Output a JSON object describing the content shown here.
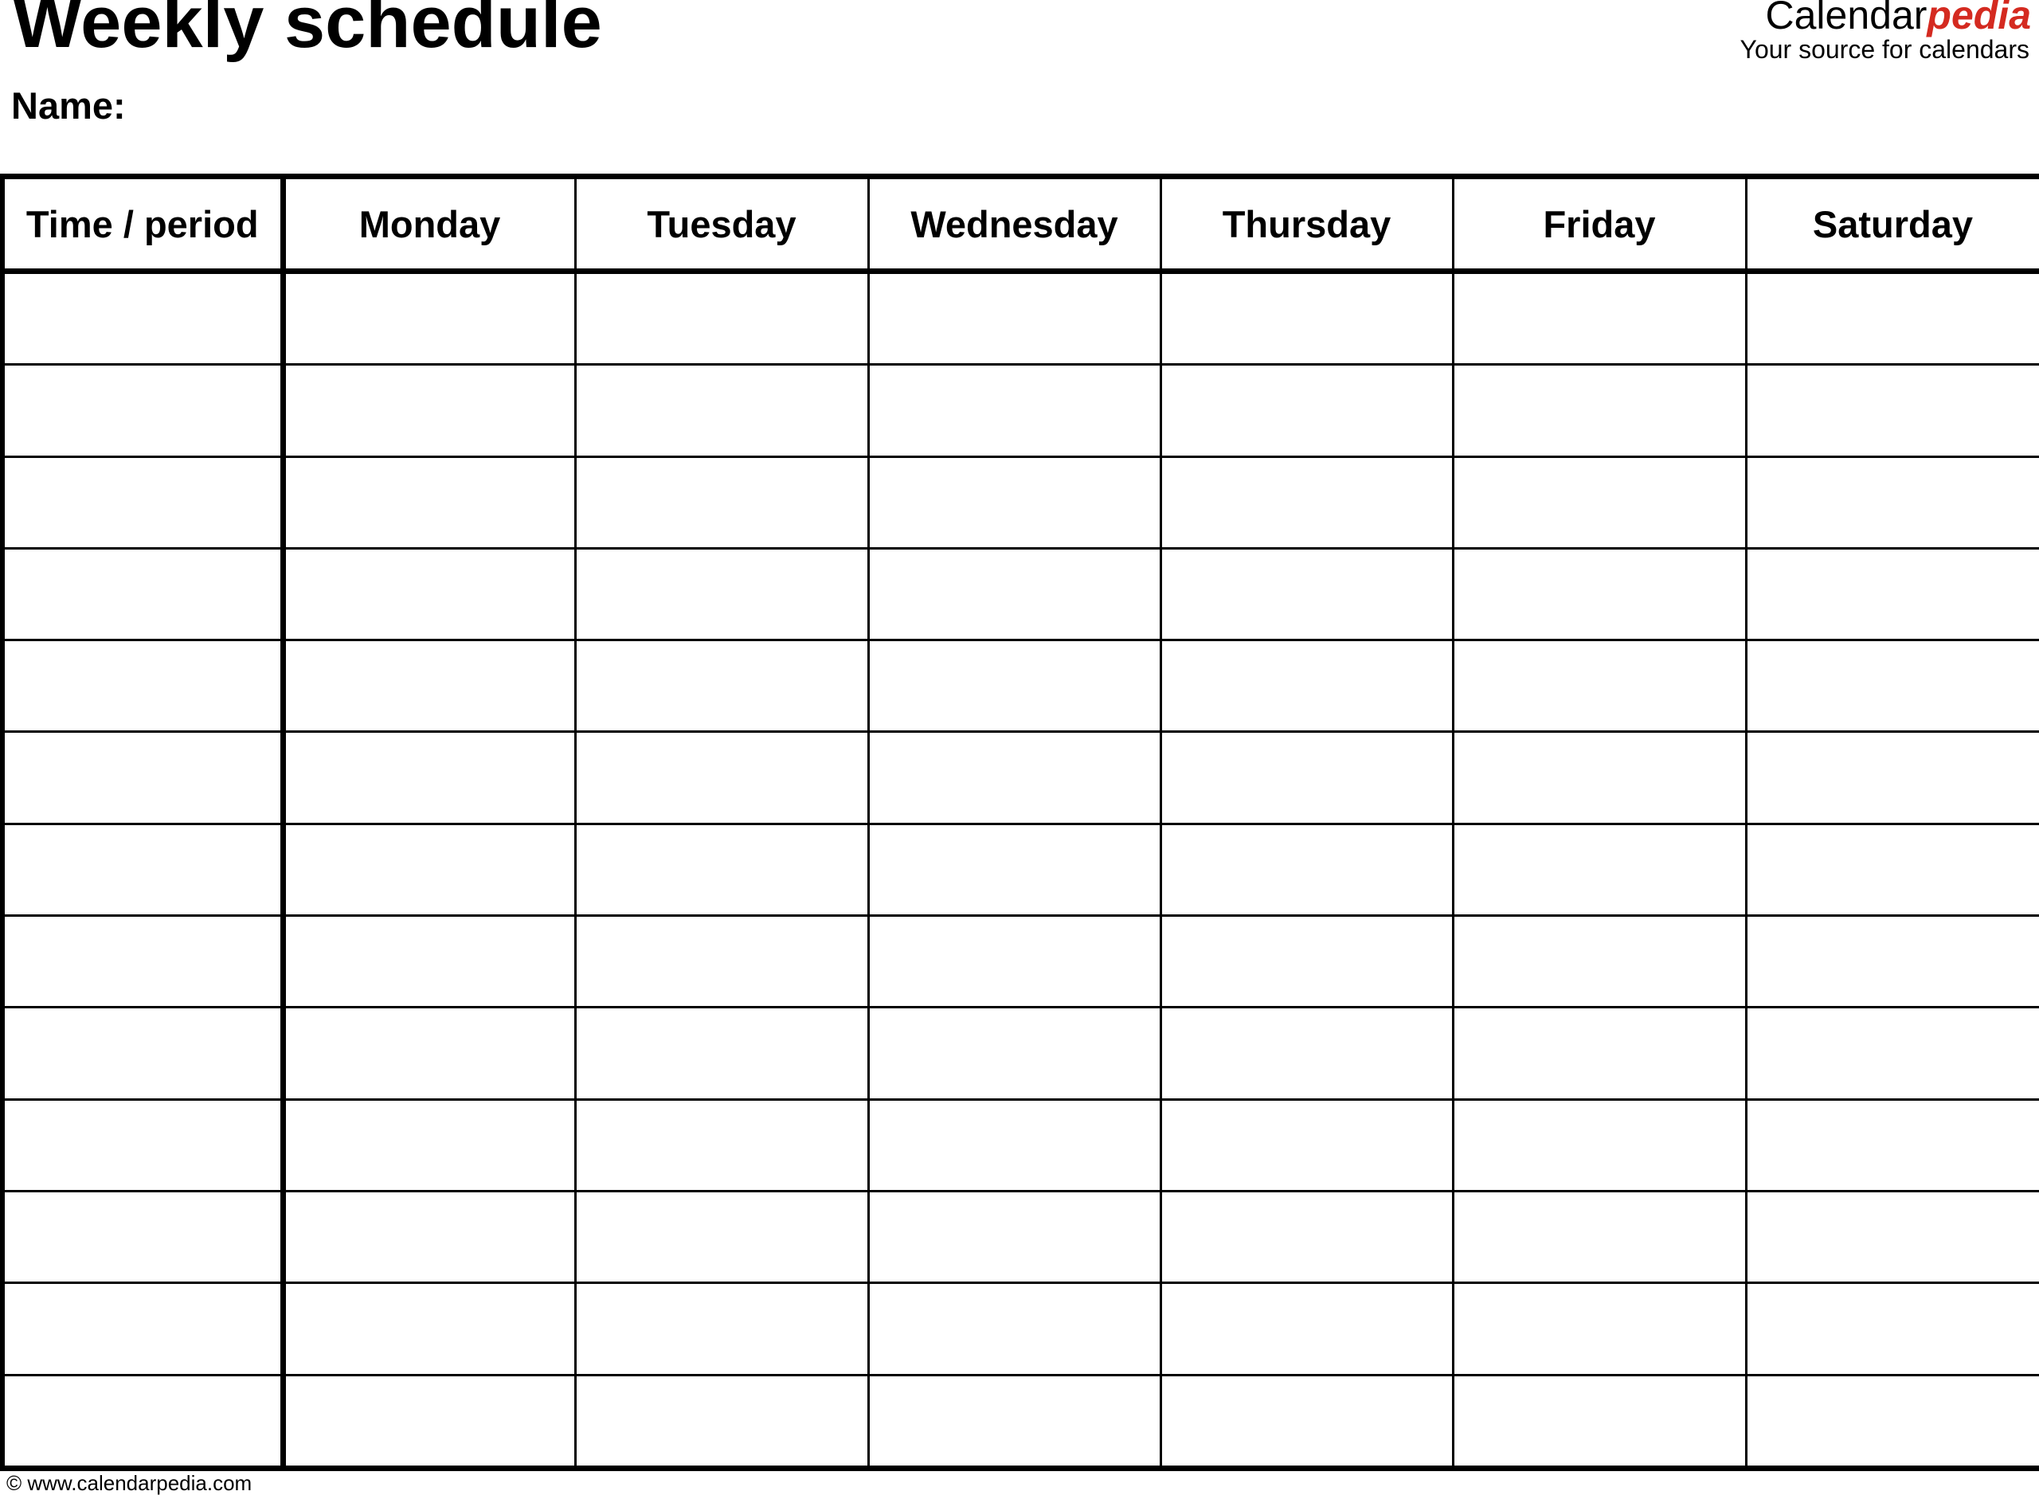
{
  "header": {
    "title": "Weekly schedule",
    "name_label": "Name:"
  },
  "logo": {
    "brand_main": "Calendar",
    "brand_accent": "pedia",
    "tagline": "Your source for calendars",
    "accent_color": "#d42a20"
  },
  "table": {
    "columns": [
      "Time / period",
      "Monday",
      "Tuesday",
      "Wednesday",
      "Thursday",
      "Friday",
      "Saturday"
    ],
    "row_count": 13,
    "rows": [
      [
        "",
        "",
        "",
        "",
        "",
        "",
        ""
      ],
      [
        "",
        "",
        "",
        "",
        "",
        "",
        ""
      ],
      [
        "",
        "",
        "",
        "",
        "",
        "",
        ""
      ],
      [
        "",
        "",
        "",
        "",
        "",
        "",
        ""
      ],
      [
        "",
        "",
        "",
        "",
        "",
        "",
        ""
      ],
      [
        "",
        "",
        "",
        "",
        "",
        "",
        ""
      ],
      [
        "",
        "",
        "",
        "",
        "",
        "",
        ""
      ],
      [
        "",
        "",
        "",
        "",
        "",
        "",
        ""
      ],
      [
        "",
        "",
        "",
        "",
        "",
        "",
        ""
      ],
      [
        "",
        "",
        "",
        "",
        "",
        "",
        ""
      ],
      [
        "",
        "",
        "",
        "",
        "",
        "",
        ""
      ],
      [
        "",
        "",
        "",
        "",
        "",
        "",
        ""
      ],
      [
        "",
        "",
        "",
        "",
        "",
        "",
        ""
      ]
    ]
  },
  "footer": {
    "copyright": "© www.calendarpedia.com"
  }
}
